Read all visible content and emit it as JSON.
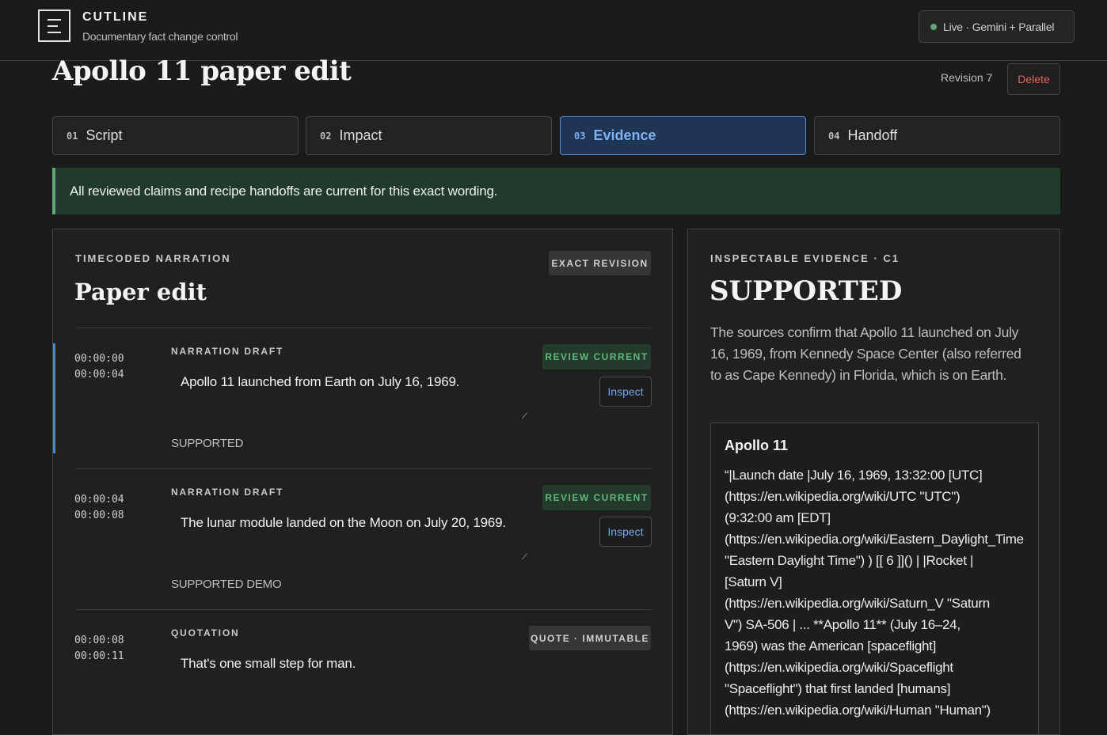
{
  "brand": {
    "name": "CUTLINE",
    "subtitle": "Documentary fact change control"
  },
  "status": {
    "label": "Live · Gemini + Parallel",
    "color": "#5fa873"
  },
  "page": {
    "title": "Apollo 11 paper edit",
    "revision": "Revision 7",
    "delete_label": "Delete"
  },
  "tabs": [
    {
      "num": "01",
      "label": "Script",
      "active": false
    },
    {
      "num": "02",
      "label": "Impact",
      "active": false
    },
    {
      "num": "03",
      "label": "Evidence",
      "active": true
    },
    {
      "num": "04",
      "label": "Handoff",
      "active": false
    }
  ],
  "banner": {
    "text": "All reviewed claims and recipe handoffs are current for this exact wording."
  },
  "narration": {
    "eyebrow": "TIMECODED NARRATION",
    "title": "Paper edit",
    "badge": "EXACT REVISION",
    "rows": [
      {
        "start": "00:00:00",
        "end": "00:00:04",
        "kind": "NARRATION DRAFT",
        "text": "Apollo 11 launched from Earth on July 16, 1969.",
        "badge": "REVIEW CURRENT",
        "inspect": "Inspect",
        "verdict": "SUPPORTED"
      },
      {
        "start": "00:00:04",
        "end": "00:00:08",
        "kind": "NARRATION DRAFT",
        "text": "The lunar module landed on the Moon on July 20, 1969.",
        "badge": "REVIEW CURRENT",
        "inspect": "Inspect",
        "verdict": "SUPPORTED DEMO"
      },
      {
        "start": "00:00:08",
        "end": "00:00:11",
        "kind": "QUOTATION",
        "text": "That's one small step for man.",
        "badge": "QUOTE · IMMUTABLE"
      }
    ]
  },
  "evidence": {
    "eyebrow": "INSPECTABLE EVIDENCE · C1",
    "verdict": "SUPPORTED",
    "summary": "The sources confirm that Apollo 11 launched on July 16, 1969, from Kennedy Space Center (also referred to as Cape Kennedy) in Florida, which is on Earth.",
    "source_title": "Apollo 11",
    "source_text": "“|Launch date |July 16, 1969, 13:32:00 [UTC]\n(https://en.wikipedia.org/wiki/UTC \"UTC\")\n(9:32:00 am [EDT]\n(https://en.wikipedia.org/wiki/Eastern_Daylight_Time\n\"Eastern Daylight Time\") ) [[ 6 ]]() | |Rocket |\n[Saturn V]\n(https://en.wikipedia.org/wiki/Saturn_V \"Saturn\nV\") SA-506 | ... **Apollo 11** (July 16–24,\n1969) was the American [spaceflight]\n(https://en.wikipedia.org/wiki/Spaceflight\n\"Spaceflight\") that first landed [humans]\n(https://en.wikipedia.org/wiki/Human \"Human\")"
  }
}
